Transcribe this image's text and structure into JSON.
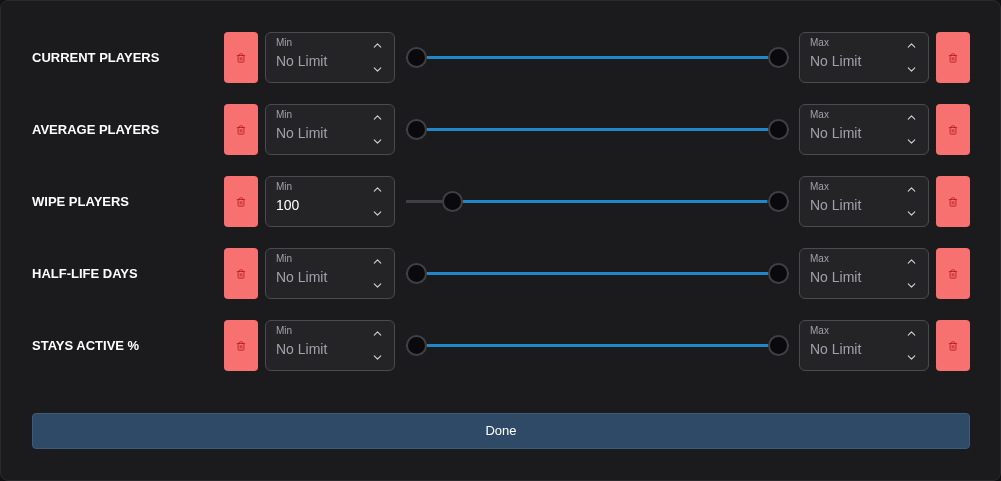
{
  "filters": [
    {
      "label": "CURRENT PLAYERS",
      "min": {
        "label": "Min",
        "placeholder": "No Limit"
      },
      "range": {
        "low": {
          "level": 0
        },
        "high": {
          "level": 1
        }
      },
      "max": {
        "label": "Max",
        "placeholder": "No Limit"
      }
    },
    {
      "label": "AVERAGE PLAYERS",
      "min": {
        "label": "Min",
        "placeholder": "No Limit"
      },
      "range": {
        "low": {
          "level": 0
        },
        "high": {
          "level": 1
        }
      },
      "max": {
        "label": "Max",
        "placeholder": "No Limit"
      }
    },
    {
      "label": "WIPE PLAYERS",
      "min": {
        "label": "Min",
        "value": "100"
      },
      "range": {
        "low": {
          "level": 0.1
        },
        "high": {
          "level": 1
        }
      },
      "max": {
        "label": "Max",
        "placeholder": "No Limit"
      }
    },
    {
      "label": "HALF-LIFE DAYS",
      "min": {
        "label": "Min",
        "placeholder": "No Limit"
      },
      "range": {
        "low": {
          "level": 0
        },
        "high": {
          "level": 1
        }
      },
      "max": {
        "label": "Max",
        "placeholder": "No Limit"
      }
    },
    {
      "label": "STAYS ACTIVE %",
      "min": {
        "label": "Min",
        "placeholder": "No Limit"
      },
      "range": {
        "low": {
          "level": 0
        },
        "high": {
          "level": 1
        }
      },
      "max": {
        "label": "Max",
        "placeholder": "No Limit"
      }
    }
  ],
  "done_button": "Done"
}
